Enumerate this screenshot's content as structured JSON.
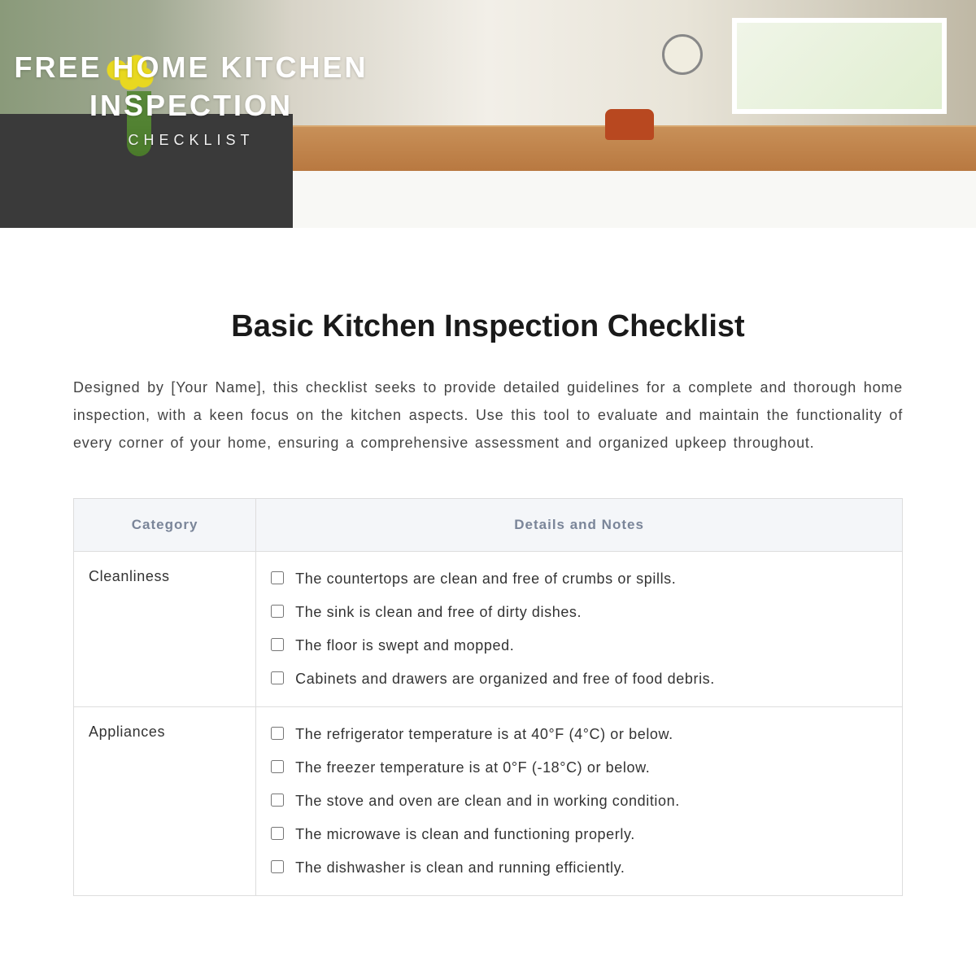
{
  "hero": {
    "title": "FREE HOME KITCHEN INSPECTION",
    "subtitle": "CHECKLIST"
  },
  "main": {
    "title": "Basic Kitchen Inspection Checklist",
    "description": "Designed by [Your Name], this checklist seeks to provide detailed guidelines for a complete and thorough home inspection, with a keen focus on the kitchen aspects. Use this tool to evaluate and maintain the functionality of every corner of your home, ensuring a comprehensive assessment and organized upkeep throughout."
  },
  "table": {
    "headers": {
      "category": "Category",
      "details": "Details and Notes"
    },
    "rows": [
      {
        "category": "Cleanliness",
        "items": [
          "The countertops are clean and free of crumbs or spills.",
          "The sink is clean and free of dirty dishes.",
          "The floor is swept and mopped.",
          "Cabinets and drawers are organized and free of food debris."
        ]
      },
      {
        "category": "Appliances",
        "items": [
          "The refrigerator temperature is at 40°F (4°C) or below.",
          "The freezer temperature is at 0°F (-18°C) or below.",
          "The stove and oven are clean and in working condition.",
          "The microwave is clean and functioning properly.",
          "The dishwasher is clean and running efficiently."
        ]
      }
    ]
  }
}
